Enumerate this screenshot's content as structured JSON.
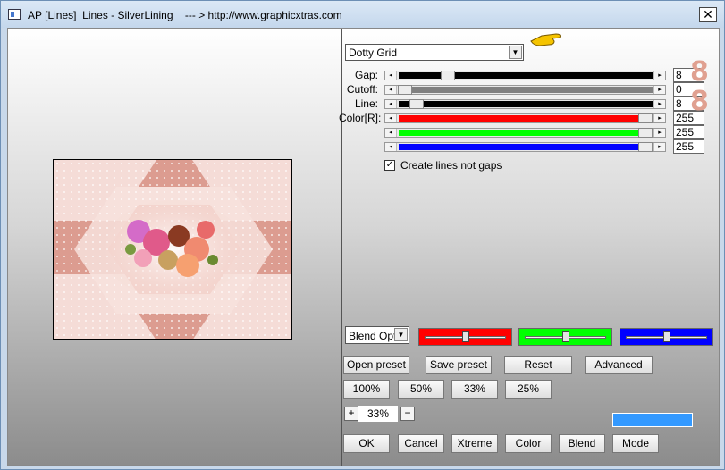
{
  "window": {
    "title": "AP [Lines]  Lines - SilverLining    --- > http://www.graphicxtras.com",
    "close_label": "✕"
  },
  "icons": {
    "app": "app-icon",
    "pointer": "pointing-hand-icon",
    "close": "close-icon"
  },
  "preset_dropdown": {
    "value": "Dotty Grid"
  },
  "params": [
    {
      "label": "Gap:",
      "value": "8",
      "fill_color": "#000000",
      "level": 0.18
    },
    {
      "label": "Cutoff:",
      "value": "0",
      "fill_color": "#808080",
      "level": 0.0
    },
    {
      "label": "Line:",
      "value": "8",
      "fill_color": "#000000",
      "level": 0.05
    },
    {
      "label": "Color[R]:",
      "value": "255",
      "fill_color": "#ff0000",
      "level": 1.0
    },
    {
      "label": "",
      "value": "255",
      "fill_color": "#00ff00",
      "level": 1.0
    },
    {
      "label": "",
      "value": "255",
      "fill_color": "#0000ff",
      "level": 1.0
    }
  ],
  "annotations": {
    "gap_mark": "8",
    "line_mark": "8"
  },
  "create_lines": {
    "label": "Create lines not gaps",
    "checked": true,
    "mark": "✓"
  },
  "blend": {
    "select_value": "Blend Optio",
    "sliders": [
      {
        "color": "#ff0000",
        "level": 0.5
      },
      {
        "color": "#00ff00",
        "level": 0.5
      },
      {
        "color": "#0000ff",
        "level": 0.5
      }
    ]
  },
  "buttons": {
    "open_preset": "Open preset",
    "save_preset": "Save preset",
    "reset": "Reset",
    "advanced": "Advanced",
    "zoom_100": "100%",
    "zoom_50": "50%",
    "zoom_33": "33%",
    "zoom_25": "25%",
    "ok": "OK",
    "cancel": "Cancel",
    "xtreme": "Xtreme",
    "color": "Color",
    "blend": "Blend",
    "mode": "Mode"
  },
  "zoom": {
    "plus": "+",
    "value": "33%",
    "minus": "−"
  },
  "preview_color": "#3399ff",
  "arrows": {
    "left": "◂",
    "right": "▸",
    "down": "▼"
  }
}
